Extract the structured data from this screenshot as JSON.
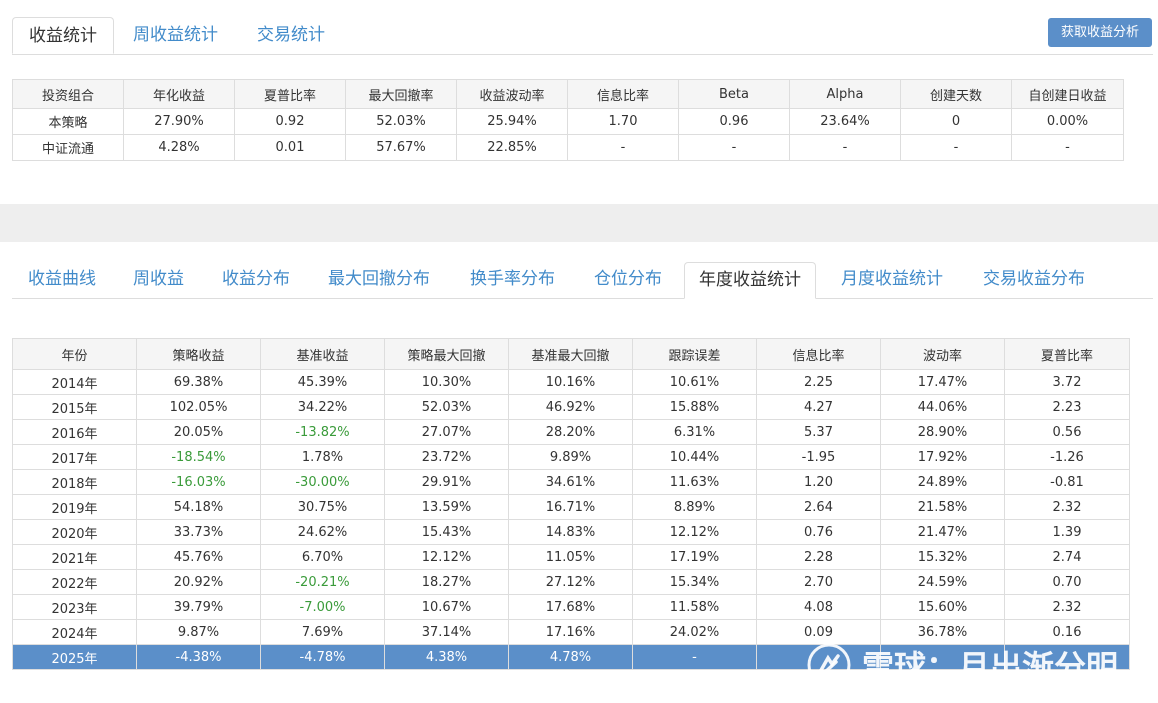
{
  "top_tabs": [
    {
      "label": "收益统计",
      "active": true
    },
    {
      "label": "周收益统计",
      "active": false
    },
    {
      "label": "交易统计",
      "active": false
    }
  ],
  "analyze_button": "获取收益分析",
  "summary": {
    "headers": [
      "投资组合",
      "年化收益",
      "夏普比率",
      "最大回撤率",
      "收益波动率",
      "信息比率",
      "Beta",
      "Alpha",
      "创建天数",
      "自创建日收益"
    ],
    "rows": [
      [
        "本策略",
        "27.90%",
        "0.92",
        "52.03%",
        "25.94%",
        "1.70",
        "0.96",
        "23.64%",
        "0",
        "0.00%"
      ],
      [
        "中证流通",
        "4.28%",
        "0.01",
        "57.67%",
        "22.85%",
        "-",
        "-",
        "-",
        "-",
        "-"
      ]
    ]
  },
  "sub_tabs": [
    {
      "label": "收益曲线",
      "active": false
    },
    {
      "label": "周收益",
      "active": false
    },
    {
      "label": "收益分布",
      "active": false
    },
    {
      "label": "最大回撤分布",
      "active": false
    },
    {
      "label": "换手率分布",
      "active": false
    },
    {
      "label": "仓位分布",
      "active": false
    },
    {
      "label": "年度收益统计",
      "active": true
    },
    {
      "label": "月度收益统计",
      "active": false
    },
    {
      "label": "交易收益分布",
      "active": false
    }
  ],
  "annual": {
    "headers": [
      "年份",
      "策略收益",
      "基准收益",
      "策略最大回撤",
      "基准最大回撤",
      "跟踪误差",
      "信息比率",
      "波动率",
      "夏普比率"
    ],
    "rows": [
      [
        "2014年",
        "69.38%",
        "45.39%",
        "10.30%",
        "10.16%",
        "10.61%",
        "2.25",
        "17.47%",
        "3.72"
      ],
      [
        "2015年",
        "102.05%",
        "34.22%",
        "52.03%",
        "46.92%",
        "15.88%",
        "4.27",
        "44.06%",
        "2.23"
      ],
      [
        "2016年",
        "20.05%",
        "-13.82%",
        "27.07%",
        "28.20%",
        "6.31%",
        "5.37",
        "28.90%",
        "0.56"
      ],
      [
        "2017年",
        "-18.54%",
        "1.78%",
        "23.72%",
        "9.89%",
        "10.44%",
        "-1.95",
        "17.92%",
        "-1.26"
      ],
      [
        "2018年",
        "-16.03%",
        "-30.00%",
        "29.91%",
        "34.61%",
        "11.63%",
        "1.20",
        "24.89%",
        "-0.81"
      ],
      [
        "2019年",
        "54.18%",
        "30.75%",
        "13.59%",
        "16.71%",
        "8.89%",
        "2.64",
        "21.58%",
        "2.32"
      ],
      [
        "2020年",
        "33.73%",
        "24.62%",
        "15.43%",
        "14.83%",
        "12.12%",
        "0.76",
        "21.47%",
        "1.39"
      ],
      [
        "2021年",
        "45.76%",
        "6.70%",
        "12.12%",
        "11.05%",
        "17.19%",
        "2.28",
        "15.32%",
        "2.74"
      ],
      [
        "2022年",
        "20.92%",
        "-20.21%",
        "18.27%",
        "27.12%",
        "15.34%",
        "2.70",
        "24.59%",
        "0.70"
      ],
      [
        "2023年",
        "39.79%",
        "-7.00%",
        "10.67%",
        "17.68%",
        "11.58%",
        "4.08",
        "15.60%",
        "2.32"
      ],
      [
        "2024年",
        "9.87%",
        "7.69%",
        "37.14%",
        "17.16%",
        "24.02%",
        "0.09",
        "36.78%",
        "0.16"
      ],
      [
        "2025年",
        "-4.38%",
        "-4.78%",
        "4.38%",
        "4.78%",
        "-",
        "",
        "",
        ""
      ]
    ]
  },
  "watermark": "雪球：月出渐分明",
  "colors": {
    "link": "#428bca",
    "button": "#5b8fc9",
    "highlight_row": "#5b8fc9",
    "negative": "#3a9b3a"
  }
}
